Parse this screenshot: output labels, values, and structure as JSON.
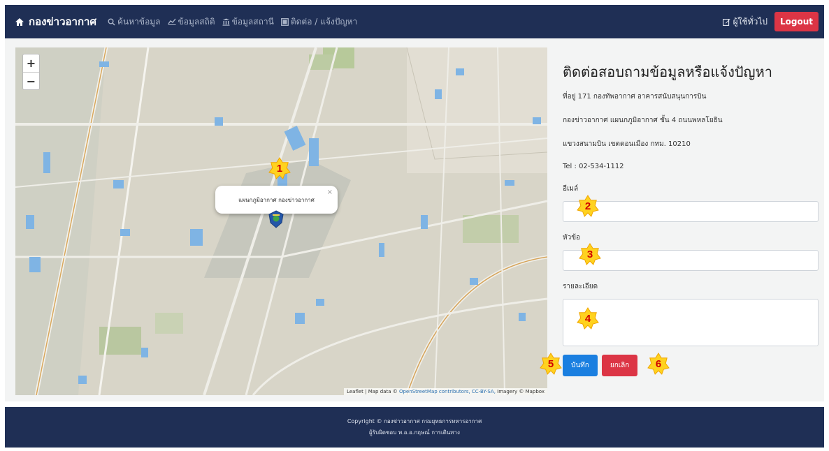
{
  "nav": {
    "brand": "กองข่าวอากาศ",
    "items": [
      {
        "label": "ค้นหาข้อมูล",
        "icon": "search-icon"
      },
      {
        "label": "ข้อมูลสถิติ",
        "icon": "chart-icon"
      },
      {
        "label": "ข้อมูลสถานี",
        "icon": "building-icon"
      },
      {
        "label": "ติดต่อ / แจ้งปัญหา",
        "icon": "contact-card-icon"
      }
    ],
    "user_label": "ผู้ใช้ทั่วไป",
    "logout_label": "Logout"
  },
  "map": {
    "popup_text": "แผนกภูมิอากาศ กองข่าวอากาศ",
    "popup_close": "×",
    "zoom_in": "+",
    "zoom_out": "−",
    "attribution_prefix": "Leaflet | Map data © ",
    "attribution_osm": "OpenStreetMap contributors, CC-BY-SA,",
    "attribution_suffix": " Imagery © Mapbox"
  },
  "contact": {
    "title": "ติดต่อสอบถามข้อมูลหรือแจ้งปัญหา",
    "address_line1": "ที่อยู่ 171 กองทัพอากาศ อาคารสนับสนุนการบิน",
    "address_line2": "กองข่าวอากาศ แผนกภูมิอากาศ ชั้น 4 ถนนพหลโยธิน",
    "address_line3": "แขวงสนามบิน เขตดอนเมือง กทม. 10210",
    "tel": "Tel : 02-534-1112",
    "email_label": "อีเมล์",
    "subject_label": "หัวข้อ",
    "detail_label": "รายละเอียด",
    "save_label": "บันทึก",
    "cancel_label": "ยกเลิก"
  },
  "footer": {
    "line1": "Copyright © กองข่าวอากาศ กรมยุทธการทหารอากาศ",
    "line2": "ผู้รับผิดชอบ พ.อ.อ.กฤษณ์ การเดินทาง"
  },
  "badges": [
    "1",
    "2",
    "3",
    "4",
    "5",
    "6"
  ],
  "colors": {
    "navbar": "#1f2f55",
    "logout": "#dc3545",
    "save": "#1a7fe0",
    "cancel": "#dc3545",
    "badge_fill": "#ffd21f",
    "badge_text": "#d00000"
  }
}
